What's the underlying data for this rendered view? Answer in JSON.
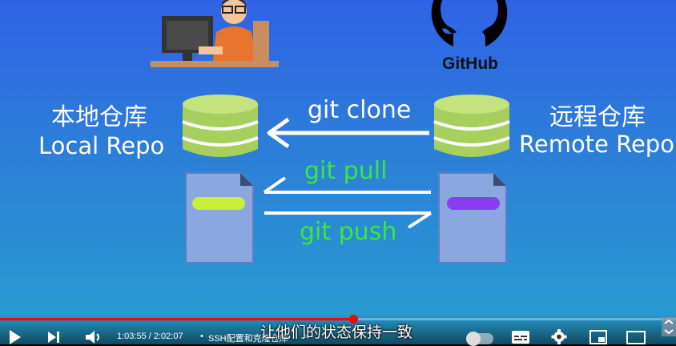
{
  "diagram": {
    "local_title_cn": "本地仓库",
    "local_title_en": "Local Repo",
    "remote_title_cn": "远程仓库",
    "remote_title_en": "Remote Repo",
    "github_label": "GitHub",
    "cmd_clone": "git clone",
    "cmd_pull": "git pull",
    "cmd_push": "git push",
    "colors": {
      "cmd_clone": "#ffffff",
      "cmd_pull_push": "#39e83a",
      "local_file_bar": "#c8ef3a",
      "remote_file_bar": "#8a3df0"
    }
  },
  "player": {
    "time": "1:03:55 / 2:02:07",
    "chapter": "SSH配置和克隆仓库",
    "subtitle": "让他们的状态保持一致",
    "progress": 0.523,
    "icons": [
      "play-icon",
      "next-icon",
      "volume-icon",
      "autoplay-toggle",
      "subtitles-icon",
      "settings-icon",
      "miniplayer-icon",
      "theater-icon"
    ]
  }
}
